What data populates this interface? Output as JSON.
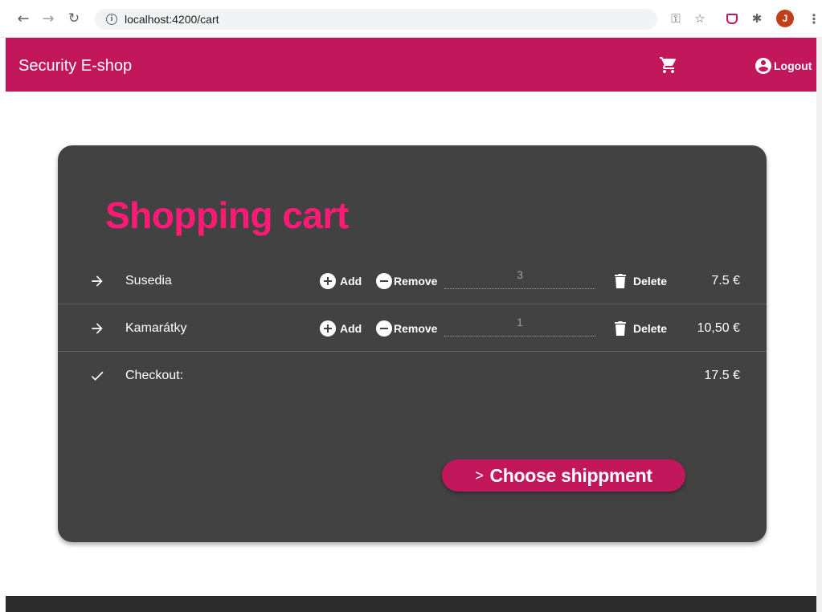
{
  "browser": {
    "url": "localhost:4200/cart",
    "profile_initial": "J"
  },
  "app": {
    "title": "Security E-shop",
    "logout_label": "Logout"
  },
  "cart": {
    "title": "Shopping cart",
    "add_label": "Add",
    "remove_label": "Remove",
    "delete_label": "Delete",
    "items": [
      {
        "name": "Susedia",
        "quantity": "3",
        "price": "7.5 €"
      },
      {
        "name": "Kamarátky",
        "quantity": "1",
        "price": "10,50 €"
      }
    ],
    "checkout_label": "Checkout:",
    "total": "17.5 €",
    "ship_button_label": "Choose shippment"
  },
  "colors": {
    "primary": "#c2185b",
    "title_pink": "#ff1a75",
    "card_bg": "#424242"
  }
}
